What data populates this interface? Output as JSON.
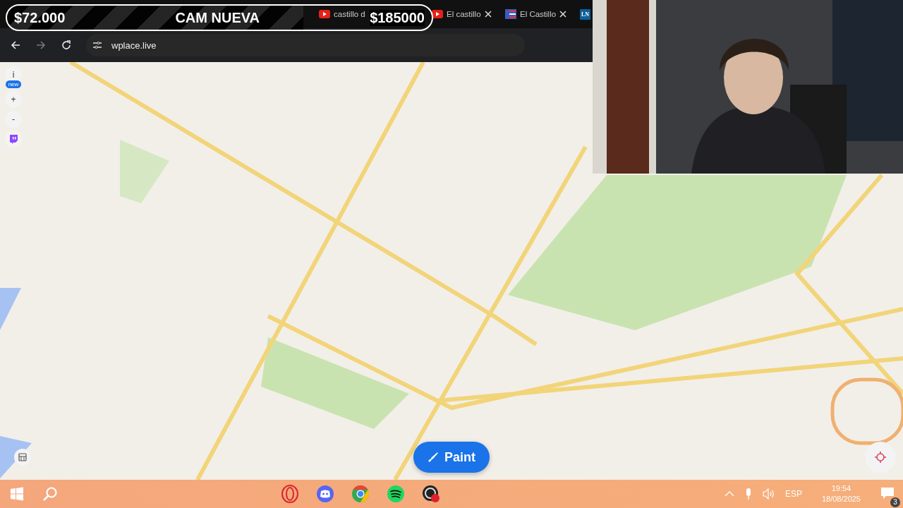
{
  "stream_overlay": {
    "left_amount": "$72.000",
    "title": "CAM NUEVA",
    "right_amount": "$185000"
  },
  "browser": {
    "tabs": [
      {
        "kind": "video",
        "title": "castillo d"
      },
      {
        "kind": "video",
        "title": "El castillo"
      },
      {
        "kind": "news",
        "title": "El Castillo"
      },
      {
        "kind": "initials",
        "favicon_text": "LN"
      }
    ],
    "url": "wplace.live"
  },
  "map": {
    "controls": [
      {
        "kind": "info",
        "label": "i"
      },
      {
        "kind": "badge",
        "label": "new"
      },
      {
        "kind": "zoom",
        "label": "+"
      },
      {
        "kind": "zoom",
        "label": "-"
      },
      {
        "kind": "twitch"
      }
    ],
    "paint_button": "Paint"
  },
  "taskbar": {
    "apps": [
      {
        "kind": "opera"
      },
      {
        "kind": "discord"
      },
      {
        "kind": "chrome"
      },
      {
        "kind": "spotify"
      },
      {
        "kind": "obs"
      }
    ],
    "tray": {
      "language": "ESP",
      "time": "19:54",
      "date": "18/08/2025",
      "notifications": "3"
    }
  }
}
